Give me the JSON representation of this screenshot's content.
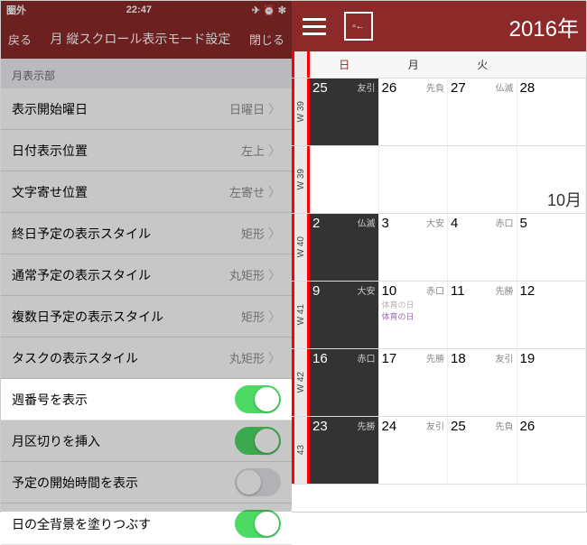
{
  "status": {
    "carrier": "圏外",
    "time": "22:47",
    "icons": "✈ ⏰ ✻"
  },
  "nav": {
    "back": "戻る",
    "title": "月 縦スクロール表示モード設定",
    "close": "閉じる"
  },
  "section": "月表示部",
  "rows": [
    {
      "label": "表示開始曜日",
      "value": "日曜日",
      "type": "disclosure"
    },
    {
      "label": "日付表示位置",
      "value": "左上",
      "type": "disclosure"
    },
    {
      "label": "文字寄せ位置",
      "value": "左寄せ",
      "type": "disclosure"
    },
    {
      "label": "終日予定の表示スタイル",
      "value": "矩形",
      "type": "disclosure"
    },
    {
      "label": "通常予定の表示スタイル",
      "value": "丸矩形",
      "type": "disclosure"
    },
    {
      "label": "複数日予定の表示スタイル",
      "value": "矩形",
      "type": "disclosure"
    },
    {
      "label": "タスクの表示スタイル",
      "value": "丸矩形",
      "type": "disclosure"
    },
    {
      "label": "週番号を表示",
      "on": true,
      "type": "switch",
      "highlight": true
    },
    {
      "label": "月区切りを挿入",
      "on": true,
      "type": "switch"
    },
    {
      "label": "予定の開始時間を表示",
      "on": false,
      "type": "switch"
    },
    {
      "label": "日の全背景を塗りつぶす",
      "on": true,
      "type": "switch"
    }
  ],
  "cal": {
    "year": "2016年",
    "dow": [
      "日",
      "月",
      "火",
      ""
    ],
    "month_label": "10月",
    "weeks": [
      {
        "w": "W 39",
        "days": [
          {
            "n": "25",
            "r": "友引",
            "dark": true
          },
          {
            "n": "26",
            "r": "先負"
          },
          {
            "n": "27",
            "r": "仏滅"
          },
          {
            "n": "28"
          }
        ]
      },
      {
        "w": "W 39",
        "month": true,
        "days": [
          {
            "n": ""
          },
          {
            "n": ""
          },
          {
            "n": ""
          },
          {
            "n": ""
          }
        ]
      },
      {
        "w": "W 40",
        "days": [
          {
            "n": "2",
            "r": "仏滅",
            "dark": true
          },
          {
            "n": "3",
            "r": "大安"
          },
          {
            "n": "4",
            "r": "赤口"
          },
          {
            "n": "5"
          }
        ]
      },
      {
        "w": "W 41",
        "days": [
          {
            "n": "9",
            "r": "大安",
            "dark": true
          },
          {
            "n": "10",
            "r": "赤口",
            "hol": [
              "体育の日",
              "体育の日"
            ]
          },
          {
            "n": "11",
            "r": "先勝"
          },
          {
            "n": "12"
          }
        ]
      },
      {
        "w": "W 42",
        "days": [
          {
            "n": "16",
            "r": "赤口",
            "dark": true
          },
          {
            "n": "17",
            "r": "先勝"
          },
          {
            "n": "18",
            "r": "友引"
          },
          {
            "n": "19"
          }
        ]
      },
      {
        "w": "43",
        "days": [
          {
            "n": "23",
            "r": "先勝",
            "dark": true
          },
          {
            "n": "24",
            "r": "友引"
          },
          {
            "n": "25",
            "r": "先負"
          },
          {
            "n": "26"
          }
        ]
      }
    ]
  }
}
